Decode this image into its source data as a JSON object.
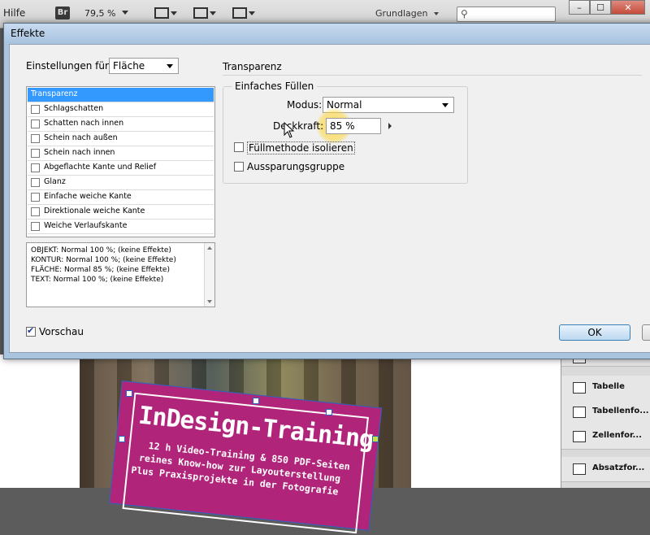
{
  "appbar": {
    "menu": "Hilfe",
    "bridge_label": "Br",
    "zoom": "79,5 %",
    "workspace": "Grundlagen",
    "search_value": "",
    "window_buttons": [
      "–",
      "☐",
      "✕"
    ]
  },
  "dialog": {
    "title": "Effekte",
    "settings_label": "Einstellungen für:",
    "settings_value": "Fläche",
    "effects": [
      {
        "label": "Transparenz",
        "selected": true,
        "checked": false
      },
      {
        "label": "Schlagschatten",
        "selected": false,
        "checked": false
      },
      {
        "label": "Schatten nach innen",
        "selected": false,
        "checked": false
      },
      {
        "label": "Schein nach außen",
        "selected": false,
        "checked": false
      },
      {
        "label": "Schein nach innen",
        "selected": false,
        "checked": false
      },
      {
        "label": "Abgeflachte Kante und Relief",
        "selected": false,
        "checked": false
      },
      {
        "label": "Glanz",
        "selected": false,
        "checked": false
      },
      {
        "label": "Einfache weiche Kante",
        "selected": false,
        "checked": false
      },
      {
        "label": "Direktionale weiche Kante",
        "selected": false,
        "checked": false
      },
      {
        "label": "Weiche Verlaufskante",
        "selected": false,
        "checked": false
      }
    ],
    "summary_lines": [
      "OBJEKT: Normal 100 %; (keine Effekte)",
      "KONTUR: Normal 100 %; (keine Effekte)",
      "FLÄCHE: Normal 85 %; (keine Effekte)",
      "TEXT: Normal 100 %; (keine Effekte)"
    ],
    "preview_label": "Vorschau",
    "preview_checked": true,
    "section_title": "Transparenz",
    "group_label": "Einfaches Füllen",
    "mode_label": "Modus:",
    "mode_value": "Normal",
    "opacity_label": "Deckkraft:",
    "opacity_value": "85 %",
    "isolate_label": "Füllmethode isolieren",
    "isolate_checked": false,
    "knockout_label": "Aussparungsgruppe",
    "knockout_checked": false,
    "ok_label": "OK"
  },
  "document": {
    "title": "InDesign-Training",
    "lines": [
      "12 h Video-Training & 850 PDF-Seiten",
      "reines Know-how zur Layouterstellung",
      "Plus Praxisprojekte in der Fotografie"
    ]
  },
  "right_panel": {
    "items": [
      "Tabelle",
      "Tabellenfo...",
      "Zellenfor...",
      "Absatzfor..."
    ]
  },
  "colors": {
    "selection": "#3399ff",
    "dialog_frame": "#aac4dd",
    "magenta": "#b0247a",
    "cursor_highlight": "#ffd73c"
  }
}
